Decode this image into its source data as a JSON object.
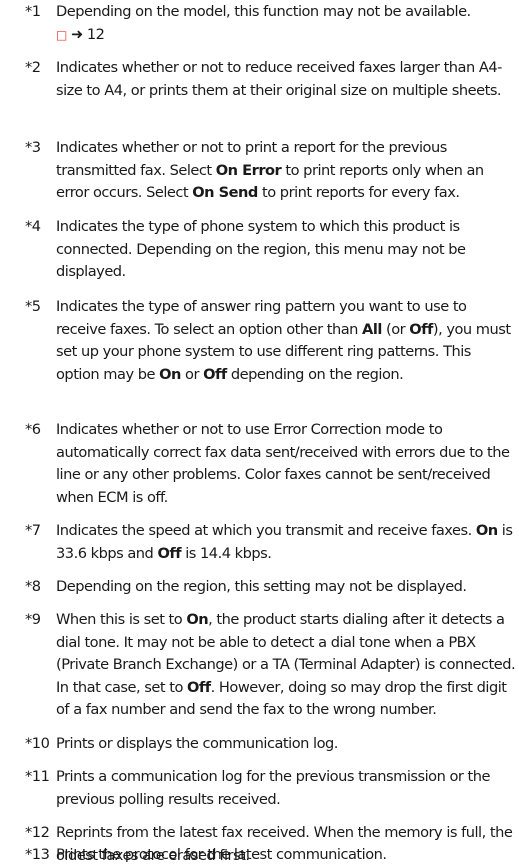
{
  "notes": [
    {
      "num": "*1",
      "parts": [
        {
          "t": "Depending on the model, this function may not be available."
        },
        {
          "br": true
        },
        {
          "icon": "book-icon",
          "t": "□"
        },
        {
          "t": " "
        },
        {
          "icon": "arrow-right-icon",
          "t": "➜"
        },
        {
          "t": " 12"
        }
      ]
    },
    {
      "num": "*2",
      "parts": [
        {
          "t": "Indicates whether or not to reduce received faxes larger than A4-size to A4, or prints them at their original size on multiple sheets."
        }
      ]
    },
    {
      "num": "*3",
      "parts": [
        {
          "t": "Indicates whether or not to print a report for the previous transmitted fax. Select "
        },
        {
          "b": "On Error"
        },
        {
          "t": " to print reports only when an error occurs. Select "
        },
        {
          "b": "On Send"
        },
        {
          "t": " to print reports for every fax."
        }
      ]
    },
    {
      "num": "*4",
      "parts": [
        {
          "t": "Indicates the type of phone system to which this product is connected. Depending on the region, this menu may not be displayed."
        }
      ]
    },
    {
      "num": "*5",
      "parts": [
        {
          "t": "Indicates the type of answer ring pattern you want to use to receive faxes. To select an option other than "
        },
        {
          "b": "All"
        },
        {
          "t": " (or "
        },
        {
          "b": "Off"
        },
        {
          "t": "), you must set up your phone system to use different ring patterns. This option may be "
        },
        {
          "b": "On"
        },
        {
          "t": " or "
        },
        {
          "b": "Off"
        },
        {
          "t": " depending on the region."
        }
      ]
    },
    {
      "num": "*6",
      "parts": [
        {
          "t": "Indicates whether or not to use Error Correction mode to automatically correct fax data sent/received with errors due to the line or any other problems. Color faxes cannot be sent/received when ECM is off."
        }
      ]
    },
    {
      "num": "*7",
      "parts": [
        {
          "t": "Indicates the speed at which you transmit and receive faxes. "
        },
        {
          "b": "On"
        },
        {
          "t": " is 33.6 kbps and "
        },
        {
          "b": "Off"
        },
        {
          "t": " is 14.4 kbps."
        }
      ]
    },
    {
      "num": "*8",
      "parts": [
        {
          "t": "Depending on the region, this setting may not be displayed."
        }
      ]
    },
    {
      "num": "*9",
      "parts": [
        {
          "t": "When this is set to "
        },
        {
          "b": "On"
        },
        {
          "t": ", the product starts dialing after it detects a dial tone. It may not be able to detect a dial tone when a PBX (Private Branch Exchange) or a TA (Terminal Adapter) is connected. In that case, set to "
        },
        {
          "b": "Off"
        },
        {
          "t": ". However, doing so may drop the first digit of a fax number and send the fax to the wrong number."
        }
      ]
    },
    {
      "num": "*10",
      "parts": [
        {
          "t": "Prints or displays the communication log."
        }
      ]
    },
    {
      "num": "*11",
      "parts": [
        {
          "t": "Prints a communication log for the previous transmission or the previous polling results received."
        }
      ]
    },
    {
      "num": "*12",
      "parts": [
        {
          "t": "Reprints from the latest fax received. When the memory is full, the oldest faxes are erased first."
        }
      ]
    },
    {
      "num": "*13",
      "parts": [
        {
          "t": "Prints the protocol for the latest communication."
        }
      ]
    }
  ]
}
